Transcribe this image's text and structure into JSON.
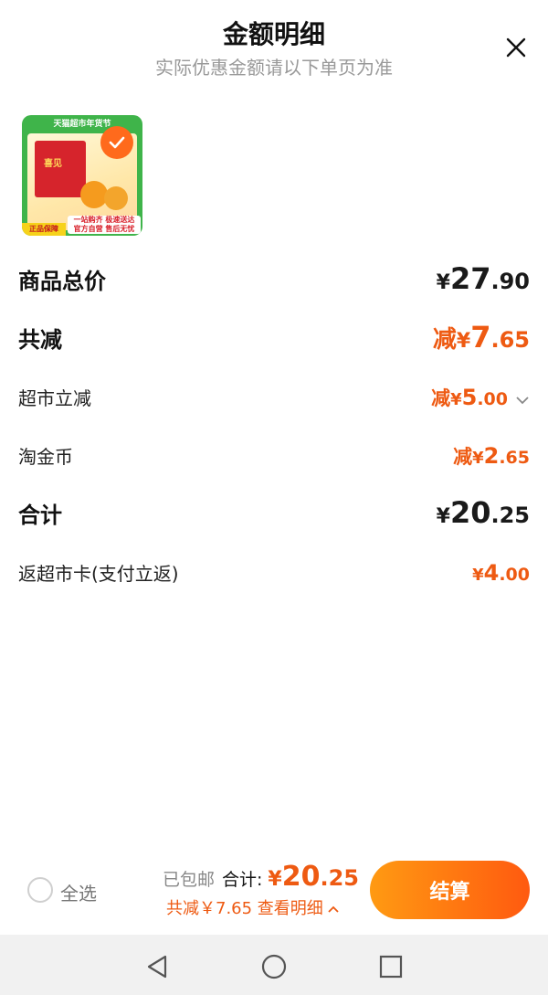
{
  "header": {
    "title": "金额明细",
    "subtitle": "实际优惠金额请以下单页为准",
    "close_icon": "close-icon"
  },
  "product": {
    "thumb_banner": "天猫超市年货节",
    "thumb_box_text": "喜见",
    "thumb_tag_line1": "一站购齐 极速送达",
    "thumb_tag_line2": "官方自营 售后无忧",
    "thumb_badge": "正品保障",
    "selected": true
  },
  "rows": {
    "goods_total": {
      "label": "商品总价",
      "yen": "¥",
      "int": "27",
      "dec": ".90"
    },
    "total_reduce": {
      "label": "共减",
      "prefix": "减",
      "yen": "¥",
      "int": "7",
      "dec": ".65"
    },
    "market_reduce": {
      "label": "超市立减",
      "prefix": "减",
      "yen": "¥",
      "int": "5",
      "dec": ".00"
    },
    "coin": {
      "label": "淘金币",
      "prefix": "减",
      "yen": "¥",
      "int": "2",
      "dec": ".65"
    },
    "sum": {
      "label": "合计",
      "yen": "¥",
      "int": "20",
      "dec": ".25"
    },
    "card_return": {
      "label": "返超市卡(支付立返)",
      "yen": "¥",
      "int": "4",
      "dec": ".00"
    }
  },
  "footer": {
    "select_all": "全选",
    "free_shipping": "已包邮",
    "total_label": "合计:",
    "total_yen": "¥",
    "total_int": "20",
    "total_dec": ".25",
    "detail_text": "共减￥7.65 查看明细",
    "checkout_label": "结算"
  },
  "colors": {
    "accent": "#ee5a12",
    "checkout_start": "#ff9a12",
    "checkout_end": "#ff5a10"
  }
}
